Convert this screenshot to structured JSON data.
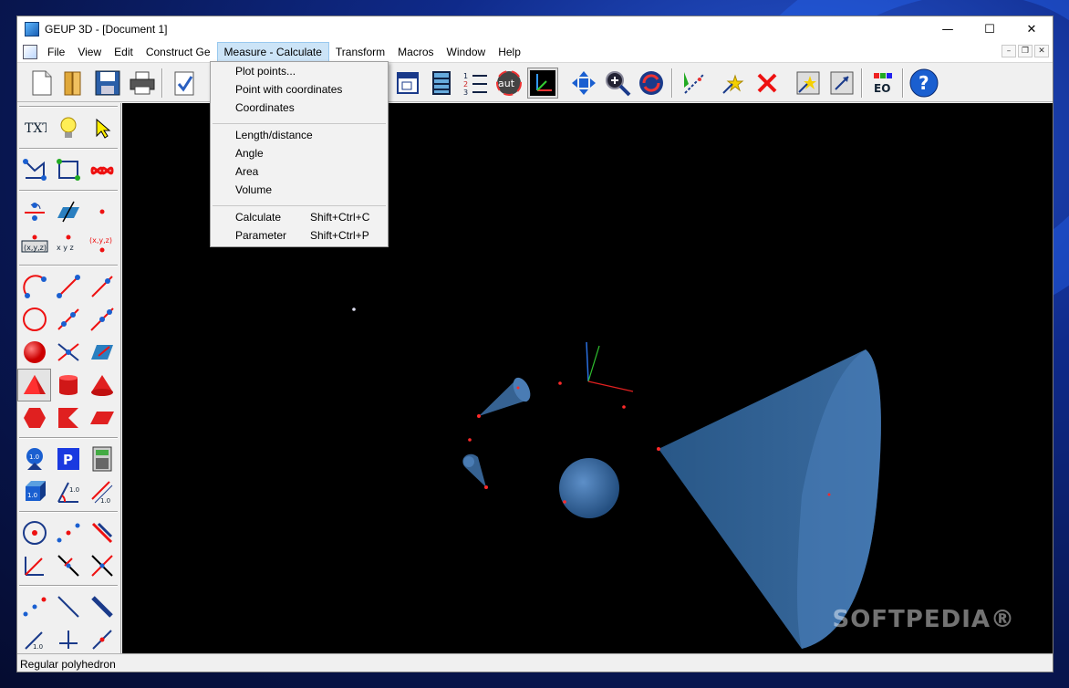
{
  "window": {
    "title": "GEUP 3D - [Document 1]",
    "controls": {
      "minimize": "—",
      "maximize": "☐",
      "close": "✕"
    }
  },
  "menubar": {
    "items": [
      "File",
      "View",
      "Edit",
      "Construct Ge",
      "Measure - Calculate",
      "Transform",
      "Macros",
      "Window",
      "Help"
    ],
    "active": "Measure - Calculate",
    "mdi": {
      "minimize": "–",
      "restore": "❐",
      "close": "✕"
    }
  },
  "dropdown": {
    "groups": [
      [
        {
          "label": "Plot points..."
        },
        {
          "label": "Point with coordinates"
        },
        {
          "label": "Coordinates"
        }
      ],
      [
        {
          "label": "Length/distance"
        },
        {
          "label": "Angle"
        },
        {
          "label": "Area"
        },
        {
          "label": "Volume"
        }
      ],
      [
        {
          "label": "Calculate",
          "shortcut": "Shift+Ctrl+C"
        },
        {
          "label": "Parameter",
          "shortcut": "Shift+Ctrl+P"
        }
      ]
    ]
  },
  "toolbar": {
    "icons": [
      "new-document-icon",
      "open-folder-icon",
      "save-icon",
      "print-icon",
      "check-document-icon",
      "window-icon",
      "film-icon",
      "numbered-list-icon",
      "auto-rotate-icon",
      "axes-icon",
      "move-arrows-icon",
      "zoom-icon",
      "rotate-icon",
      "trace-icon",
      "light-icon",
      "delete-icon",
      "show-hide-icon",
      "resize-icon",
      "eo-icon",
      "help-icon"
    ],
    "aut_text": "aut",
    "eo_text": "EO",
    "help_text": "?"
  },
  "palette": {
    "text_tool": "TXT",
    "xyz_label": "x y z",
    "xyz_paren": "(x,y,z)",
    "xyz_box": "(x,y,z)",
    "p_label": "P",
    "measure_label": "1.0"
  },
  "statusbar": {
    "text": "Regular polyhedron"
  },
  "watermark": "SOFTPEDIA®",
  "colors": {
    "canvas": "#000000",
    "solid": "#3f6fa3",
    "point": "#ff2a2a",
    "menu_highlight": "#cce4f7"
  }
}
